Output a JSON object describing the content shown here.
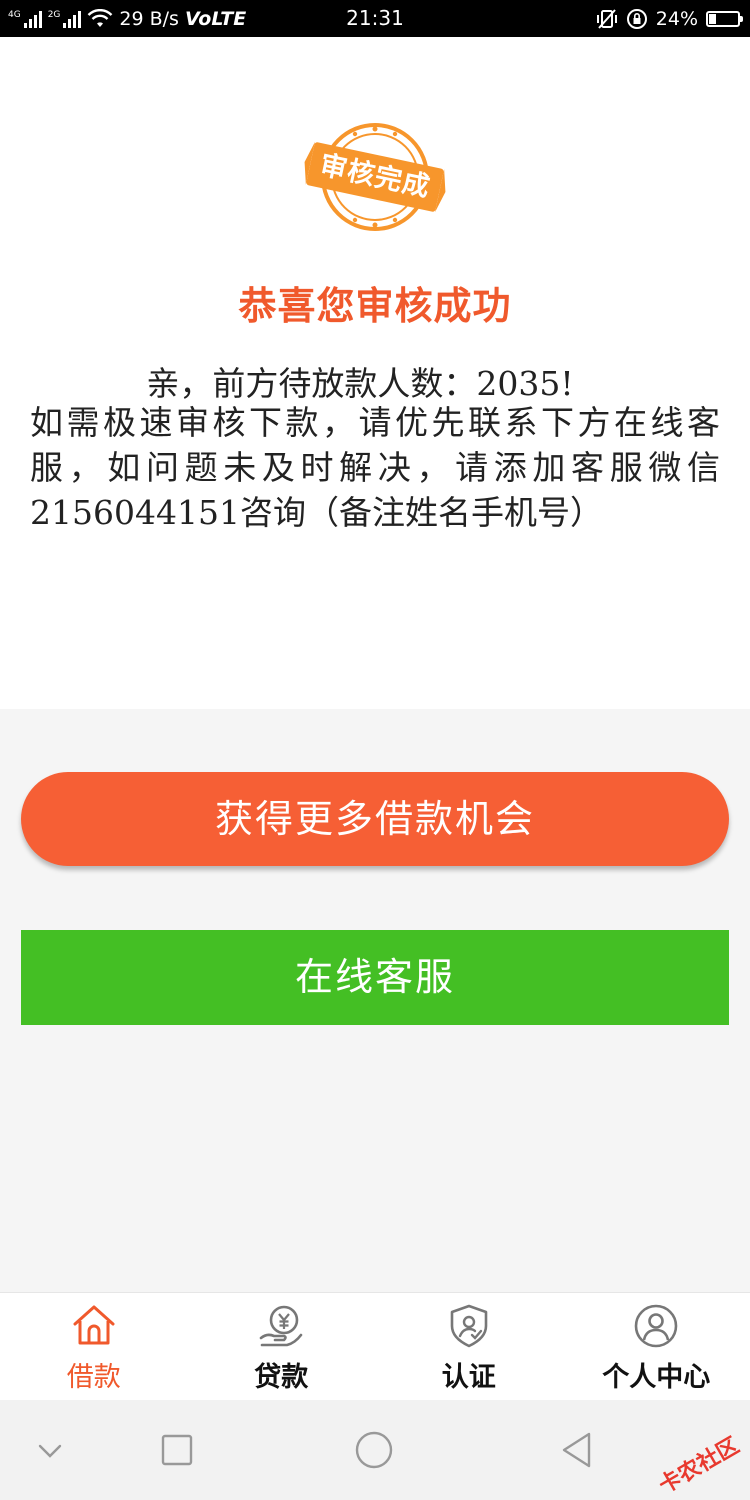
{
  "status_bar": {
    "net_left": "4G",
    "net_right": "2G",
    "speed": "29 B/s",
    "volte": "VoLTE",
    "time": "21:31",
    "battery": "24%",
    "battery_level": 0.24
  },
  "result": {
    "stamp_text": "审核完成",
    "title": "恭喜您审核成功",
    "queue_line": "亲，前方待放款人数：2035!",
    "message": "如需极速审核下款，请优先联系下方在线客服，如问题未及时解决，请添加客服微信2156044151咨询（备注姓名手机号）",
    "accent_color": "#f0592c"
  },
  "buttons": {
    "more_loans": "获得更多借款机会",
    "online_service": "在线客服",
    "more_loans_color": "#f65f35",
    "online_service_color": "#44bf24"
  },
  "tabs": [
    {
      "label": "借款",
      "icon": "home-icon",
      "active": true
    },
    {
      "label": "贷款",
      "icon": "yuan-hand-icon",
      "active": false
    },
    {
      "label": "认证",
      "icon": "shield-user-icon",
      "active": false
    },
    {
      "label": "个人中心",
      "icon": "user-circle-icon",
      "active": false
    }
  ],
  "watermark": "卡农社区"
}
